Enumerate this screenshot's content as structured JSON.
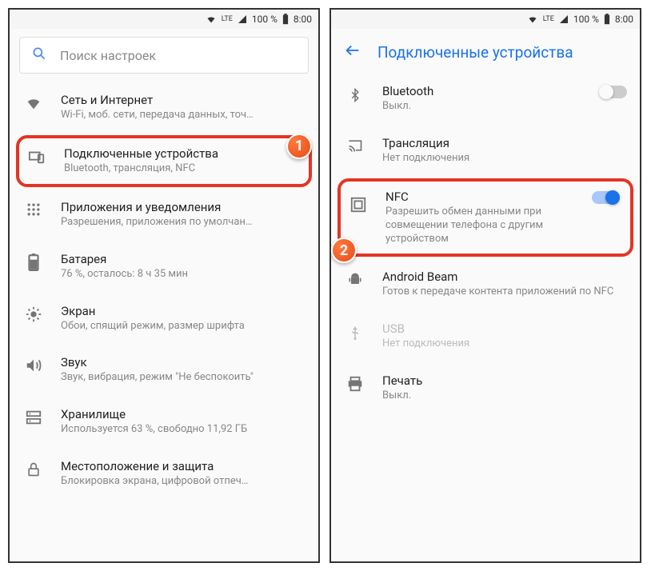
{
  "status": {
    "signal": "LTE",
    "battery_pct": "100 %",
    "time": "8:00"
  },
  "left": {
    "search_placeholder": "Поиск настроек",
    "items": [
      {
        "title": "Сеть и Интернет",
        "sub": "Wi-Fi, моб. сети, передача данных, точ…"
      },
      {
        "title": "Подключенные устройства",
        "sub": "Bluetooth, трансляция, NFC"
      },
      {
        "title": "Приложения и уведомления",
        "sub": "Разрешения, приложения по умолчан…"
      },
      {
        "title": "Батарея",
        "sub": "76 %, осталось: 8 ч 35 мин"
      },
      {
        "title": "Экран",
        "sub": "Обои, спящий режим, размер шрифта"
      },
      {
        "title": "Звук",
        "sub": "Звук, вибрация, режим \"Не беспокоить\""
      },
      {
        "title": "Хранилище",
        "sub": "Используется 63 %, свободно 11,92 ГБ"
      },
      {
        "title": "Местоположение и защита",
        "sub": "Блокировка экрана, цифровой отпеч…"
      }
    ],
    "badge": "1"
  },
  "right": {
    "header": "Подключенные устройства",
    "items": [
      {
        "title": "Bluetooth",
        "sub": "Выкл.",
        "toggle": "off"
      },
      {
        "title": "Трансляция",
        "sub": "Нет подключения"
      },
      {
        "title": "NFC",
        "sub": "Разрешить обмен данными при совмещении телефона с другим устройством",
        "toggle": "on"
      },
      {
        "title": "Android Beam",
        "sub": "Готов к передаче контента приложений по NFC"
      },
      {
        "title": "USB",
        "sub": "Нет подключения",
        "muted": true
      },
      {
        "title": "Печать",
        "sub": "Выкл."
      }
    ],
    "badge": "2"
  }
}
